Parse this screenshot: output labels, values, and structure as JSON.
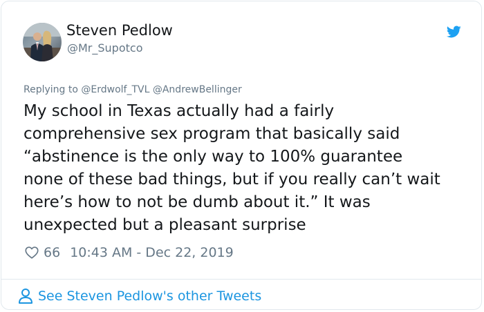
{
  "user": {
    "name": "Steven Pedlow",
    "handle": "@Mr_Supotco"
  },
  "tweet": {
    "reply_prefix": "Replying to",
    "mentions": [
      "@Erdwolf_TVL",
      "@AndrewBellinger"
    ],
    "lines": [
      "My school in Texas actually had a fairly",
      "comprehensive sex program that basically said",
      "“abstinence is the only way to 100% guarantee",
      "none of these bad things, but if you really can’t wait",
      "here’s how to not be dumb about it.” It was",
      "unexpected but a pleasant surprise"
    ],
    "likes": "66",
    "timestamp": "10:43 AM - Dec 22, 2019"
  },
  "footer": {
    "link_text": "See Steven Pedlow's other Tweets"
  },
  "icons": {
    "brand": "twitter-bird-icon",
    "like": "heart-outline-icon",
    "profile": "person-outline-icon"
  },
  "colors": {
    "brand_blue": "#1da1f2",
    "link_blue": "#1b95e0",
    "secondary_text": "#657786",
    "primary_text": "#14171a",
    "border": "#e1e8ed"
  }
}
